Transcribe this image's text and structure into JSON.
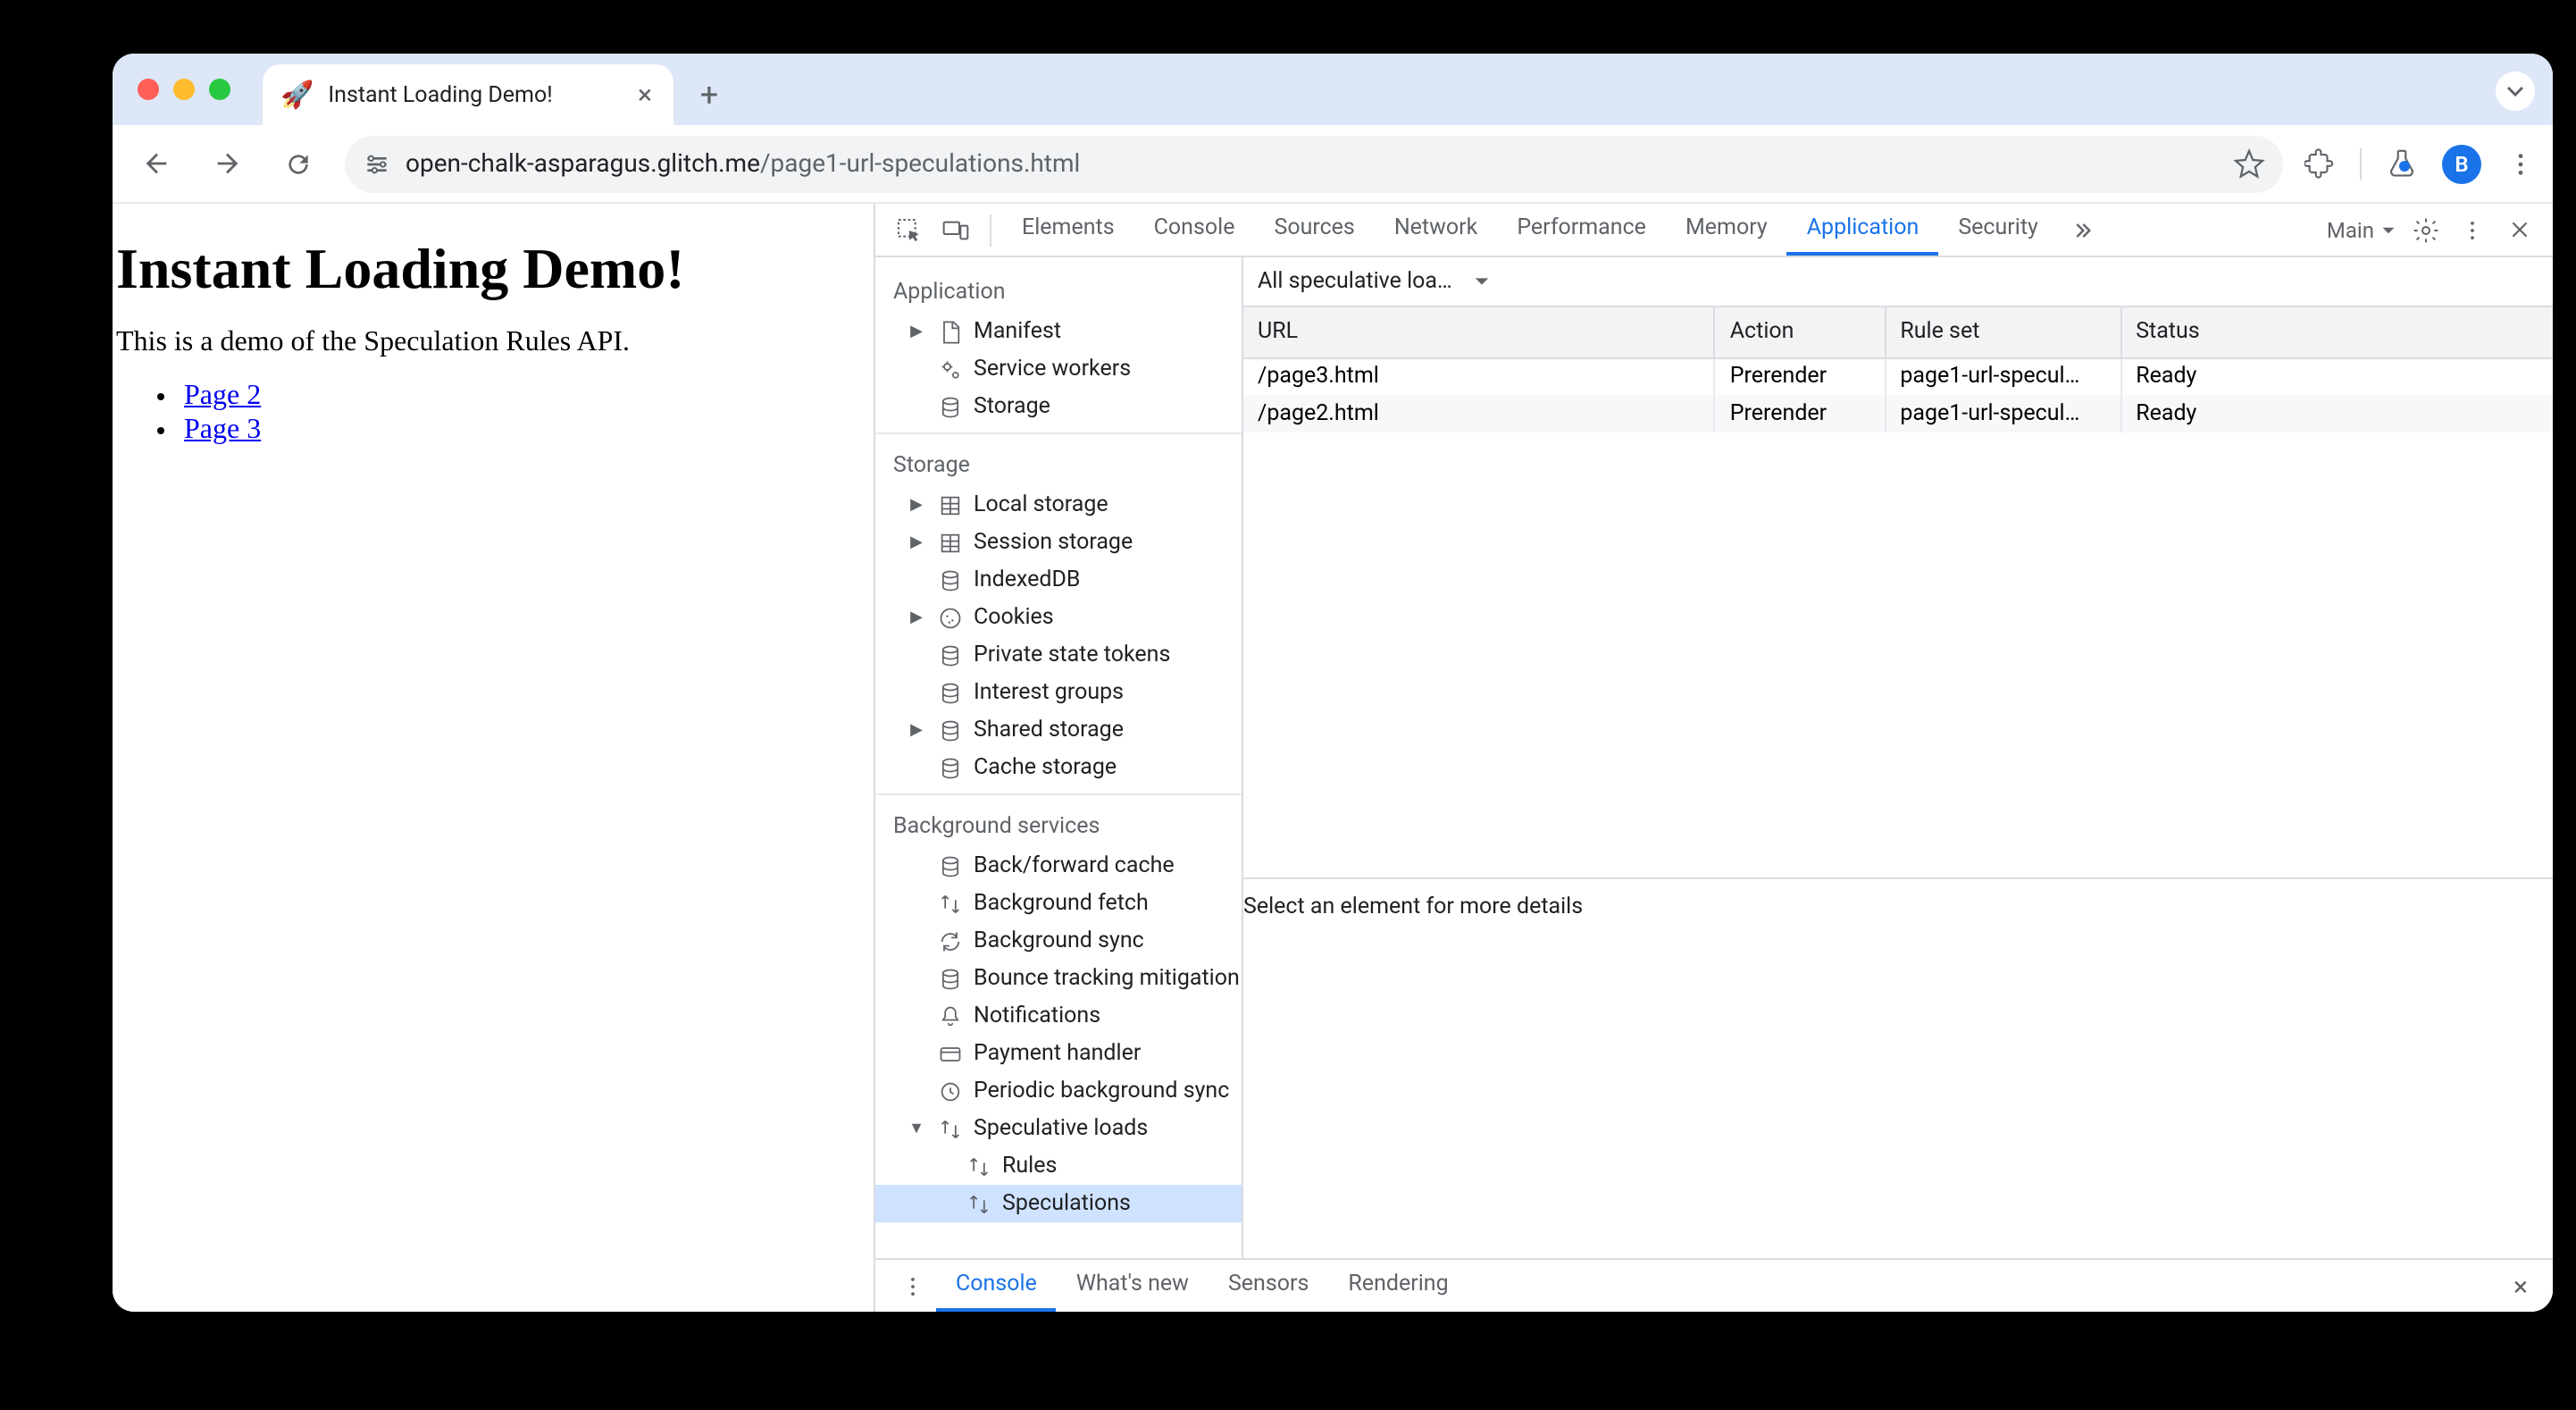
{
  "browser": {
    "tab_title": "Instant Loading Demo!",
    "favicon": "🚀",
    "url_host": "open-chalk-asparagus.glitch.me",
    "url_path": "/page1-url-speculations.html",
    "avatar_letter": "B"
  },
  "page": {
    "heading": "Instant Loading Demo!",
    "intro": "This is a demo of the Speculation Rules API.",
    "links": [
      {
        "text": "Page 2"
      },
      {
        "text": "Page 3"
      }
    ]
  },
  "devtools": {
    "tabs": [
      "Elements",
      "Console",
      "Sources",
      "Network",
      "Performance",
      "Memory",
      "Application",
      "Security"
    ],
    "active_tab": "Application",
    "target_label": "Main",
    "drawer_tabs": [
      "Console",
      "What's new",
      "Sensors",
      "Rendering"
    ],
    "drawer_active": "Console",
    "filter_label": "All speculative loa…",
    "table_headers": [
      "URL",
      "Action",
      "Rule set",
      "Status"
    ],
    "rows": [
      {
        "url": "/page3.html",
        "action": "Prerender",
        "ruleset": "page1-url-specul…",
        "status": "Ready"
      },
      {
        "url": "/page2.html",
        "action": "Prerender",
        "ruleset": "page1-url-specul…",
        "status": "Ready"
      }
    ],
    "details_placeholder": "Select an element for more details",
    "sidebar": {
      "sections": [
        {
          "title": "Application",
          "items": [
            {
              "label": "Manifest",
              "icon": "file",
              "expandable": true
            },
            {
              "label": "Service workers",
              "icon": "gears"
            },
            {
              "label": "Storage",
              "icon": "db"
            }
          ]
        },
        {
          "title": "Storage",
          "items": [
            {
              "label": "Local storage",
              "icon": "grid",
              "expandable": true
            },
            {
              "label": "Session storage",
              "icon": "grid",
              "expandable": true
            },
            {
              "label": "IndexedDB",
              "icon": "db"
            },
            {
              "label": "Cookies",
              "icon": "cookie",
              "expandable": true
            },
            {
              "label": "Private state tokens",
              "icon": "db"
            },
            {
              "label": "Interest groups",
              "icon": "db"
            },
            {
              "label": "Shared storage",
              "icon": "db",
              "expandable": true
            },
            {
              "label": "Cache storage",
              "icon": "db"
            }
          ]
        },
        {
          "title": "Background services",
          "items": [
            {
              "label": "Back/forward cache",
              "icon": "db"
            },
            {
              "label": "Background fetch",
              "icon": "swap"
            },
            {
              "label": "Background sync",
              "icon": "sync"
            },
            {
              "label": "Bounce tracking mitigation",
              "icon": "db"
            },
            {
              "label": "Notifications",
              "icon": "bell"
            },
            {
              "label": "Payment handler",
              "icon": "card"
            },
            {
              "label": "Periodic background sync",
              "icon": "clock"
            },
            {
              "label": "Speculative loads",
              "icon": "swap",
              "expandable": true,
              "expanded": true,
              "children": [
                {
                  "label": "Rules",
                  "icon": "swap"
                },
                {
                  "label": "Speculations",
                  "icon": "swap",
                  "selected": true
                }
              ]
            }
          ]
        }
      ]
    }
  }
}
